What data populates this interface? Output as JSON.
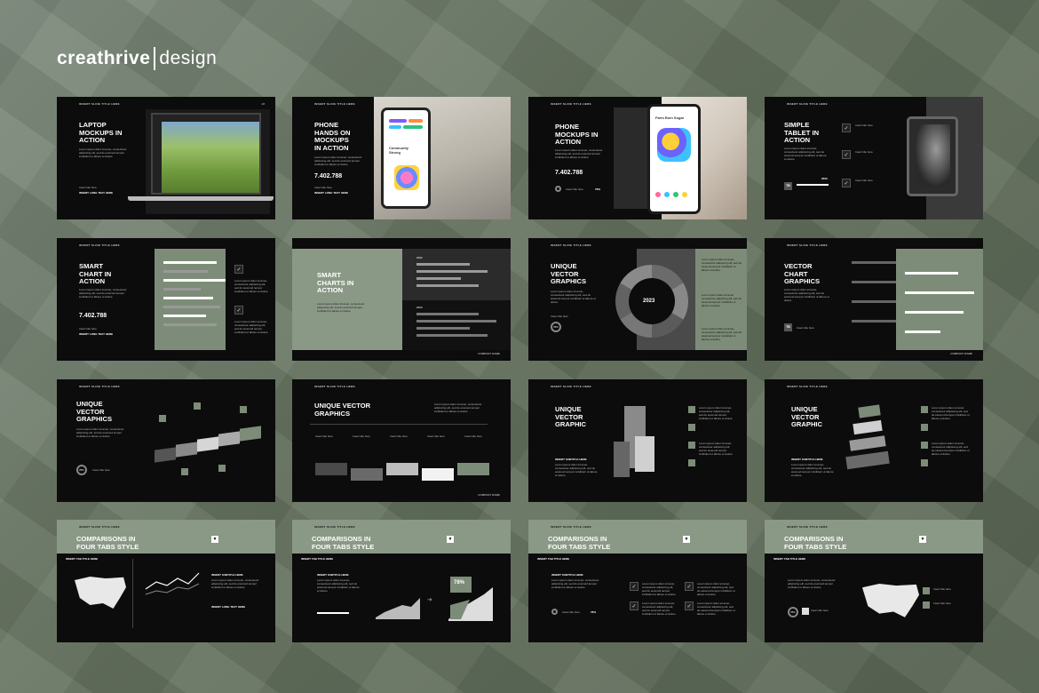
{
  "brand": {
    "name_bold": "creathrive",
    "name_light": "design"
  },
  "colors": {
    "sage": "#7d8c78",
    "dark": "#0c0c0c",
    "background": "#66735f"
  },
  "common": {
    "tag": "INSERT SLIDE TITLE HERE",
    "footer": "COMPANY NAME",
    "body": "Lorem ipsum dolor sit amet, consectetur adipiscing elit, sed do eiusmod tempor incididunt ut labore et dolore",
    "item": "Insert title here",
    "insert_long": "INSERT LONG TEXT HERE",
    "insert_subtitle": "INSERT SUBTITLE HERE",
    "insert_tab": "INSERT TAB TITLE HERE"
  },
  "slides": [
    {
      "title": "LAPTOP\nMOCKUPS IN\nACTION"
    },
    {
      "title": "PHONE\nHANDS ON\nMOCKUPS\nIN ACTION",
      "number": "7.402.788",
      "app_title": "Community\nStrong"
    },
    {
      "title": "PHONE\nMOCKUPS IN\nACTION",
      "number": "7.402.788",
      "app_title": "Farm Earn Sugar",
      "percent": "78%"
    },
    {
      "title": "SIMPLE\nTABLET IN\nACTION",
      "year": "2023",
      "label": "TB"
    },
    {
      "title": "SMART\nCHART IN\nACTION",
      "number": "7.402.788"
    },
    {
      "title": "SMART\nCHARTS IN\nACTION",
      "year_a": "2022",
      "year_b": "2023"
    },
    {
      "title": "UNIQUE\nVECTOR\nGRAPHICS",
      "year": "2023",
      "percent": "78%"
    },
    {
      "title": "VECTOR\nCHART\nGRAPHICS",
      "label": "TB"
    },
    {
      "title": "UNIQUE\nVECTOR\nGRAPHICS",
      "percent": "78%"
    },
    {
      "title": "UNIQUE VECTOR\nGRAPHICS"
    },
    {
      "title": "UNIQUE\nVECTOR\nGRAPHIC"
    },
    {
      "title": "UNIQUE\nVECTOR\nGRAPHIC"
    },
    {
      "title": "COMPARISONS IN\nFOUR TABS STYLE"
    },
    {
      "title": "COMPARISONS IN\nFOUR TABS STYLE",
      "percent": "78%"
    },
    {
      "title": "COMPARISONS IN\nFOUR TABS STYLE",
      "percent": "78%"
    },
    {
      "title": "COMPARISONS IN\nFOUR TABS STYLE",
      "percent": "78%"
    }
  ]
}
